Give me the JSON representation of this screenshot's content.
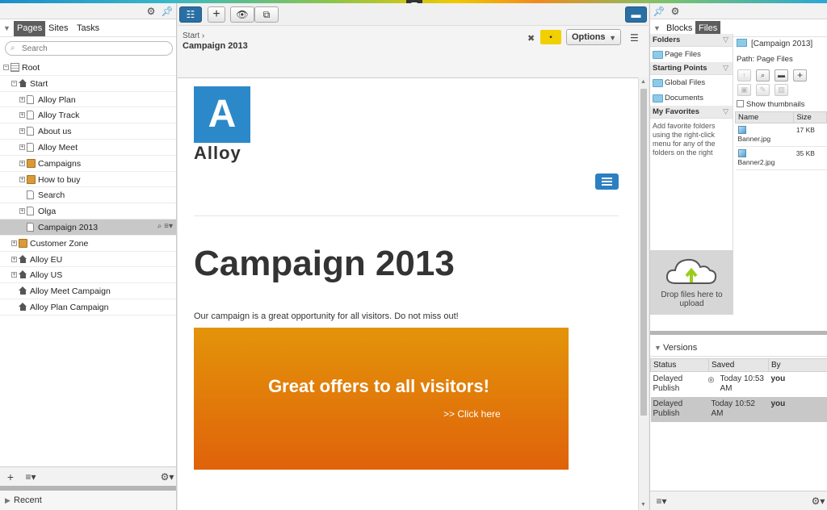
{
  "left": {
    "tabs": [
      {
        "label": "Pages",
        "active": true
      },
      {
        "label": "Sites",
        "active": false
      },
      {
        "label": "Tasks",
        "active": false
      }
    ],
    "search_placeholder": "Search",
    "tree": [
      {
        "label": "Root",
        "level": 0,
        "icon": "root",
        "expand": "minus"
      },
      {
        "label": "Start",
        "level": 1,
        "icon": "home",
        "expand": "minus"
      },
      {
        "label": "Alloy Plan",
        "level": 2,
        "icon": "page",
        "expand": "plus"
      },
      {
        "label": "Alloy Track",
        "level": 2,
        "icon": "page",
        "expand": "plus"
      },
      {
        "label": "About us",
        "level": 2,
        "icon": "page",
        "expand": "plus"
      },
      {
        "label": "Alloy Meet",
        "level": 2,
        "icon": "page",
        "expand": "plus"
      },
      {
        "label": "Campaigns",
        "level": 2,
        "icon": "folder",
        "expand": "plus"
      },
      {
        "label": "How to buy",
        "level": 2,
        "icon": "folder",
        "expand": "plus"
      },
      {
        "label": "Search",
        "level": 2,
        "icon": "page",
        "expand": "none"
      },
      {
        "label": "Olga",
        "level": 2,
        "icon": "page",
        "expand": "plus"
      },
      {
        "label": "Campaign 2013",
        "level": 2,
        "icon": "page",
        "expand": "none",
        "selected": true
      },
      {
        "label": "Customer Zone",
        "level": 1,
        "icon": "folder",
        "expand": "plus"
      },
      {
        "label": "Alloy EU",
        "level": 1,
        "icon": "home",
        "expand": "plus"
      },
      {
        "label": "Alloy US",
        "level": 1,
        "icon": "home",
        "expand": "plus"
      },
      {
        "label": "Alloy Meet Campaign",
        "level": 1,
        "icon": "home",
        "expand": "none"
      },
      {
        "label": "Alloy Plan Campaign",
        "level": 1,
        "icon": "home",
        "expand": "none"
      }
    ],
    "recent_label": "Recent"
  },
  "center": {
    "breadcrumb": "Start",
    "title": "Campaign 2013",
    "options_label": "Options",
    "preview": {
      "logo_letter": "A",
      "logo_text": "Alloy",
      "heading": "Campaign 2013",
      "intro": "Our campaign is a great opportunity for all visitors. Do not miss out!",
      "banner_heading": "Great offers to all visitors!",
      "banner_link": ">> Click here"
    }
  },
  "right": {
    "tabs": [
      {
        "label": "Blocks",
        "active": false
      },
      {
        "label": "Files",
        "active": true
      }
    ],
    "folders_header": "Folders",
    "folders": [
      "Page Files"
    ],
    "starting_points_header": "Starting Points",
    "starting_points": [
      "Global Files",
      "Documents"
    ],
    "favorites_header": "My Favorites",
    "favorites_text": "Add favorite folders using the right-click menu for any of the folders on the right",
    "drop_text": "Drop files here to upload",
    "current_folder": "[Campaign 2013]",
    "path_label": "Path: Page Files",
    "show_thumbnails": "Show thumbnails",
    "file_columns": [
      "Name",
      "Size"
    ],
    "files": [
      {
        "name": "Banner.jpg",
        "size": "17 KB"
      },
      {
        "name": "Banner2.jpg",
        "size": "35 KB"
      }
    ],
    "versions_label": "Versions",
    "version_columns": [
      "Status",
      "Saved",
      "By"
    ],
    "versions": [
      {
        "status": "Delayed Publish",
        "saved": "Today 10:53 AM",
        "by": "you",
        "selected": false
      },
      {
        "status": "Delayed Publish",
        "saved": "Today 10:52 AM",
        "by": "you",
        "selected": true
      }
    ]
  },
  "colors": {
    "accent_blue": "#2c89c9",
    "selection_gray": "#c8c8c8",
    "comment_yellow": "#f2d000",
    "banner_orange": "#e0620a"
  }
}
